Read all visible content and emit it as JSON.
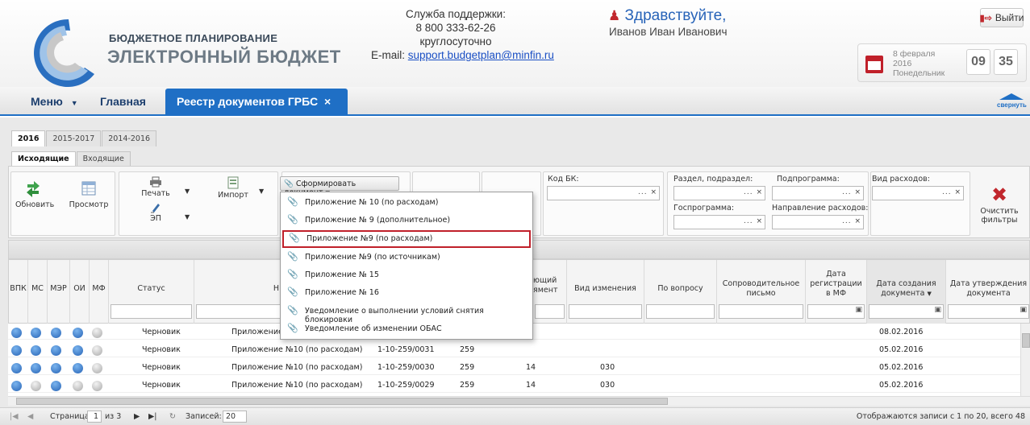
{
  "header": {
    "brand_top": "БЮДЖЕТНОЕ ПЛАНИРОВАНИЕ",
    "brand_bottom": "ЭЛЕКТРОННЫЙ БЮДЖЕТ",
    "support_title": "Служба поддержки:",
    "support_phone": "8 800 333-62-26",
    "support_hours": "круглосуточно",
    "support_email_label": "E-mail:",
    "support_email": "support.budgetplan@minfin.ru",
    "greeting": "Здравствуйте,",
    "user_name": "Иванов Иван Иванович",
    "exit_label": "Выйти",
    "date_line1": "8 февраля",
    "date_line2": "2016",
    "date_line3": "Понедельник",
    "time_hours": "09",
    "time_minutes": "35"
  },
  "nav": {
    "menu_label": "Меню",
    "main_label": "Главная",
    "active_tab": "Реестр документов ГРБС",
    "collapse_label": "свернуть"
  },
  "year_tabs": [
    "2016",
    "2015-2017",
    "2014-2016"
  ],
  "direction_tabs": [
    "Исходящие",
    "Входящие"
  ],
  "toolbar": {
    "refresh": "Обновить",
    "view": "Просмотр",
    "print": "Печать",
    "ep": "ЭП",
    "import": "Импорт",
    "form_document": "Сформировать документ",
    "code_bk_label": "Код БК:",
    "section_label": "Раздел, подраздел:",
    "subprogram_label": "Подпрограмма:",
    "expense_type_label": "Вид расходов:",
    "gosprogram_label": "Госпрограмма:",
    "expense_direction_label": "Направление расходов:",
    "clear_filters_l1": "Очистить",
    "clear_filters_l2": "фильтры",
    "field_buttons": "... ×"
  },
  "dropdown_items": [
    "Приложение № 10 (по расходам)",
    "Приложение № 9 (дополнительное)",
    "Приложение №9 (по расходам)",
    "Приложение №9 (по источникам)",
    "Приложение № 15",
    "Приложение № 16",
    "Уведомление о выполнении условий снятия блокировки",
    "Уведомление об изменении ОБАС"
  ],
  "columns": {
    "vpk": "ВПК",
    "ms": "МС",
    "mer": "МЭР",
    "oi": "ОИ",
    "mf": "МФ",
    "status": "Статус",
    "name_partial": "Н",
    "dept_l1": "ющий",
    "dept_l2": "ямент",
    "change_type": "Вид изменения",
    "question": "По вопросу",
    "cover_l1": "Сопроводительное",
    "cover_l2": "письмо",
    "reg_l1": "Дата",
    "reg_l2": "регистрации",
    "reg_l3": "в МФ",
    "created_l1": "Дата создания",
    "created_l2": "документа",
    "approved_l1": "Дата утверждения",
    "approved_l2": "документа"
  },
  "rows": [
    {
      "dots": [
        "blue",
        "blue",
        "blue",
        "blue",
        "grey"
      ],
      "status": "Черновик",
      "name": "Приложение",
      "number": "",
      "grbs": "",
      "dept": "",
      "change": "",
      "created": "08.02.2016"
    },
    {
      "dots": [
        "blue",
        "blue",
        "blue",
        "blue",
        "grey"
      ],
      "status": "Черновик",
      "name": "Приложение №10 (по расходам)",
      "number": "1-10-259/0031",
      "grbs": "259",
      "dept": "",
      "change": "",
      "created": "05.02.2016"
    },
    {
      "dots": [
        "blue",
        "blue",
        "blue",
        "blue",
        "grey"
      ],
      "status": "Черновик",
      "name": "Приложение №10 (по расходам)",
      "number": "1-10-259/0030",
      "grbs": "259",
      "dept": "14",
      "change": "030",
      "created": "05.02.2016"
    },
    {
      "dots": [
        "blue",
        "grey",
        "blue",
        "grey",
        "grey"
      ],
      "status": "Черновик",
      "name": "Приложение №10 (по расходам)",
      "number": "1-10-259/0029",
      "grbs": "259",
      "dept": "14",
      "change": "030",
      "created": "05.02.2016"
    }
  ],
  "pager": {
    "page_label": "Страница",
    "page_value": "1",
    "of_label": "из 3",
    "records_label": "Записей:",
    "records_value": "20",
    "summary": "Отображаются записи с 1 по 20, всего 48"
  }
}
